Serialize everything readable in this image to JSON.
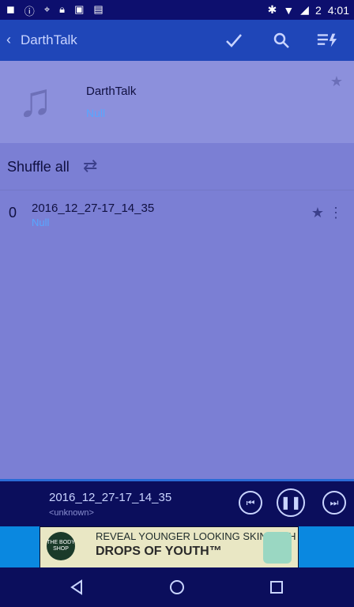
{
  "status": {
    "time": "4:01",
    "battery": "2"
  },
  "toolbar": {
    "back_symbol": "‹",
    "title": "DarthTalk"
  },
  "album": {
    "title": "DarthTalk",
    "subtitle": "Null"
  },
  "shuffle": {
    "label": "Shuffle all"
  },
  "track": {
    "index": "0",
    "title": "2016_12_27-17_14_35",
    "subtitle": "Null"
  },
  "player": {
    "title": "2016_12_27-17_14_35",
    "subtitle": "<unknown>"
  },
  "ad": {
    "brand": "THE BODY SHOP",
    "line1": "REVEAL YOUNGER LOOKING SKIN WITH",
    "line2": "DROPS OF YOUTH™"
  },
  "colors": {
    "toolbar": "#1f46b8",
    "status": "#0d0f6e",
    "content": "#7b7fd4",
    "accent": "#58a6ff"
  },
  "icons": {
    "check": "check-icon",
    "search": "search-icon",
    "queue": "queue-icon",
    "star": "star-icon",
    "shuffle": "shuffle-icon",
    "more": "more-icon",
    "prev": "previous-icon",
    "pause": "pause-icon",
    "next": "next-icon",
    "back": "back-nav-icon",
    "home": "home-nav-icon",
    "recents": "recents-nav-icon"
  }
}
